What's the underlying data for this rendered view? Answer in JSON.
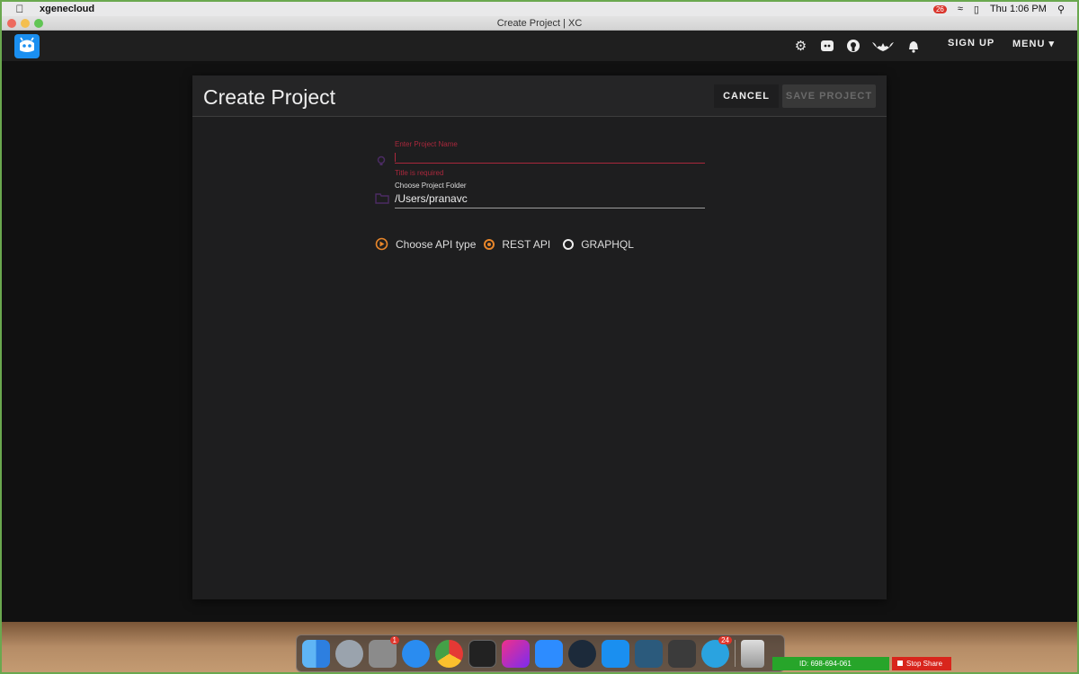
{
  "menubar": {
    "app_name": "xgenecloud",
    "clock": "Thu 1:06 PM",
    "badge_count": "26"
  },
  "window": {
    "title": "Create Project | XC"
  },
  "header": {
    "sign_up_label": "SIGN UP",
    "menu_label": "MENU"
  },
  "card": {
    "title": "Create Project",
    "cancel_label": "CANCEL",
    "save_label": "SAVE PROJECT"
  },
  "form": {
    "project_name": {
      "label": "Enter Project Name",
      "value": "",
      "error": "Title is required"
    },
    "project_folder": {
      "label": "Choose Project Folder",
      "value": "/Users/pranavc"
    },
    "api_type": {
      "label": "Choose API type",
      "options": [
        "REST API",
        "GRAPHQL"
      ],
      "selected": "REST API"
    }
  },
  "dock": {
    "system_prefs_badge": "1",
    "telegram_badge": "24"
  },
  "screen_share": {
    "id_text": "ID: 698-694-061",
    "stop_label": "Stop Share"
  },
  "colors": {
    "error": "#a9283c",
    "accent": "#e8862a",
    "brand": "#1a8ff0"
  }
}
